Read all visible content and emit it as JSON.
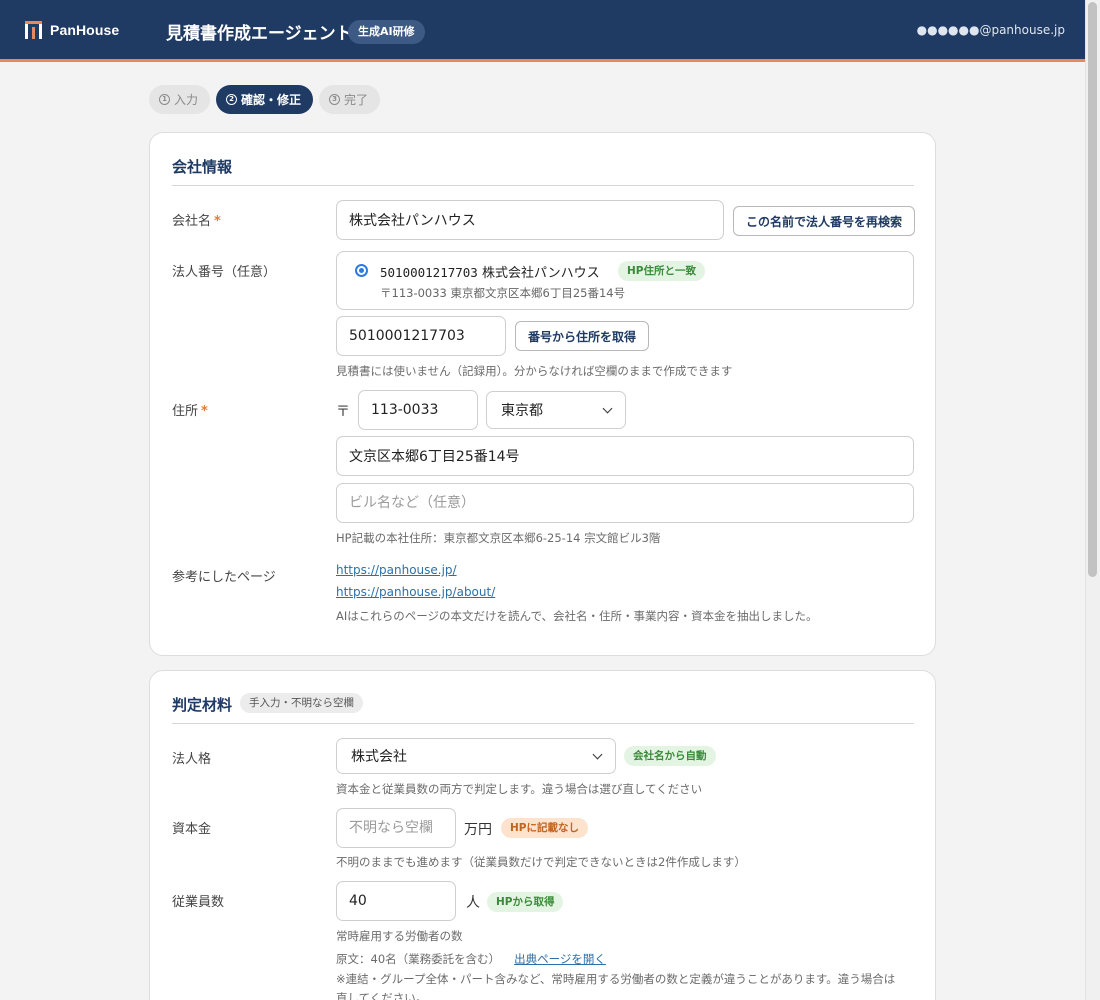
{
  "header": {
    "logo_text": "PanHouse",
    "title": "見積書作成エージェント",
    "badge": "生成AI研修",
    "user_email": "●●●●●●@panhouse.jp"
  },
  "steps": [
    {
      "num": "1",
      "label": "入力",
      "active": false
    },
    {
      "num": "2",
      "label": "確認・修正",
      "active": true
    },
    {
      "num": "3",
      "label": "完了",
      "active": false
    }
  ],
  "company": {
    "section_title": "会社情報",
    "name_label": "会社名",
    "name_value": "株式会社パンハウス",
    "research_button": "この名前で法人番号を再検索",
    "corp_number_label": "法人番号（任意）",
    "candidate": {
      "number": "5010001217703",
      "name": "株式会社パンハウス",
      "match_tag": "HP住所と一致",
      "address": "〒113-0033 東京都文京区本郷6丁目25番14号"
    },
    "corp_number_value": "5010001217703",
    "fetch_address_button": "番号から住所を取得",
    "corp_number_help": "見積書には使いません（記録用）。分からなければ空欄のままで作成できます",
    "address_label": "住所",
    "postal_mark": "〒",
    "postal_code": "113-0033",
    "prefecture": "東京都",
    "address_line": "文京区本郷6丁目25番14号",
    "building_placeholder": "ビル名など（任意）",
    "address_help": "HP記載の本社住所：東京都文京区本郷6-25-14 宗文館ビル3階",
    "refs_label": "参考にしたページ",
    "refs": [
      "https://panhouse.jp/",
      "https://panhouse.jp/about/"
    ],
    "refs_help": "AIはこれらのページの本文だけを読んで、会社名・住所・事業内容・資本金を抽出しました。"
  },
  "judgement": {
    "section_title": "判定材料",
    "section_tag": "手入力・不明なら空欄",
    "entity_label": "法人格",
    "entity_value": "株式会社",
    "entity_tag": "会社名から自動",
    "entity_help": "資本金と従業員数の両方で判定します。違う場合は選び直してください",
    "capital_label": "資本金",
    "capital_placeholder": "不明なら空欄",
    "capital_unit": "万円",
    "capital_tag": "HPに記載なし",
    "capital_help": "不明のままでも進めます（従業員数だけで判定できないときは2件作成します）",
    "employees_label": "従業員数",
    "employees_value": "40",
    "employees_unit": "人",
    "employees_tag": "HPから取得",
    "employees_help": "常時雇用する労働者の数",
    "employees_source": "原文：40名（業務委託を含む）",
    "source_link": "出典ページを開く",
    "employees_note": "※連結・グループ全体・パート含みなど、常時雇用する労働者の数と定義が違うことがあります。違う場合は直してください。"
  },
  "colors": {
    "header_bg": "#1f3a63",
    "accent": "#e58a5c",
    "required": "#e07b3c",
    "link": "#2d6fa8"
  }
}
